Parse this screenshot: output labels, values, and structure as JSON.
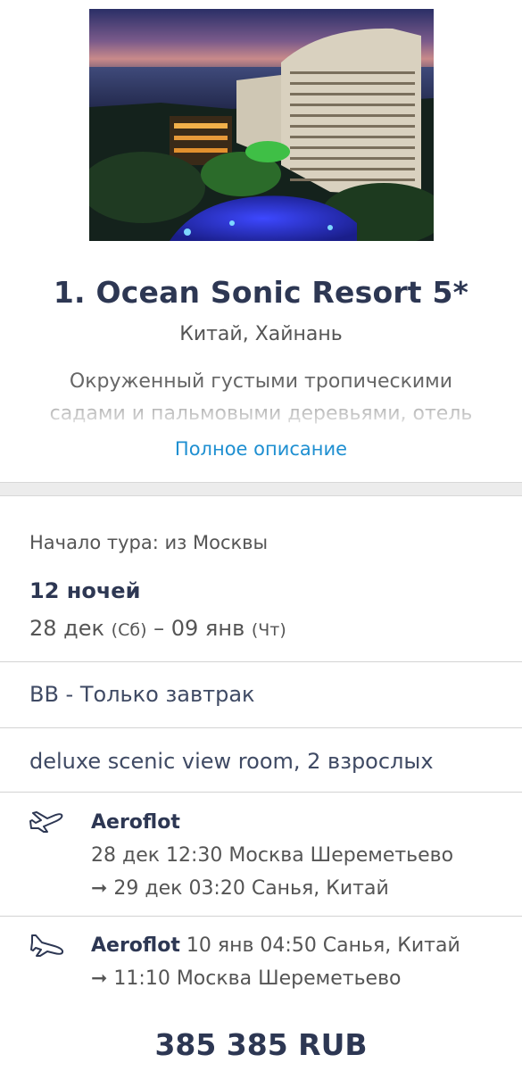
{
  "hotel": {
    "title": "1. Ocean Sonic Resort 5*",
    "location": "Китай, Хайнань",
    "description_line1": "Окруженный густыми тропическими",
    "description_line2": "садами и пальмовыми деревьями, отель",
    "full_description_link": "Полное описание",
    "photo_icon": "hotel-photo"
  },
  "tour": {
    "start": "Начало тура: из Москвы",
    "nights": "12 ночей",
    "date_from": "28 дек",
    "dow_from": "(Сб)",
    "dash": "–",
    "date_to": "09 янв",
    "dow_to": "(Чт)"
  },
  "meal": "BB - Только завтрак",
  "room": "deluxe scenic view room, 2 взрослых",
  "flights": {
    "outbound": {
      "icon": "plane-takeoff-icon",
      "airline": "Aeroflot",
      "line1": "28 дек 12:30 Москва Шереметьево",
      "line2": "➞ 29 дек 03:20 Санья, Китай"
    },
    "return": {
      "icon": "plane-landing-icon",
      "airline": "Aeroflot",
      "line1_rest": " 10 янв 04:50 Санья, Китай",
      "line2": "➞ 11:10 Москва Шереметьево"
    }
  },
  "price": "385 385 RUB",
  "colors": {
    "title": "#2d3753",
    "link": "#1e8fd1",
    "divider": "#d3d3d3"
  }
}
